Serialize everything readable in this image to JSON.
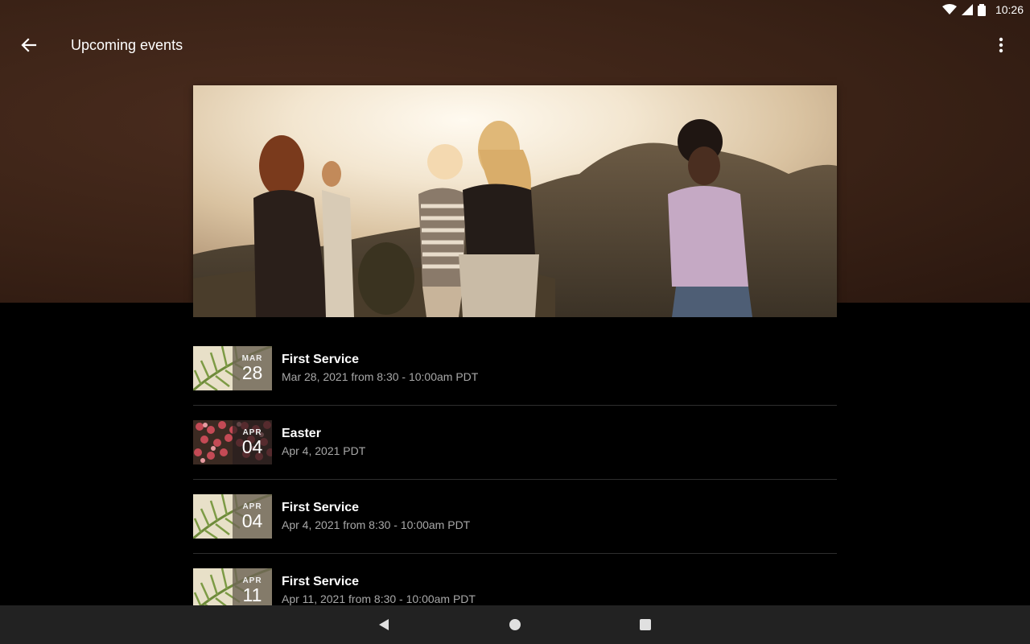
{
  "status_bar": {
    "time": "10:26",
    "icons": [
      "wifi-icon",
      "cellular-signal-icon",
      "battery-icon"
    ]
  },
  "app_bar": {
    "title": "Upcoming events",
    "back_icon": "arrow-back-icon",
    "menu_icon": "more-vert-icon"
  },
  "hero": {
    "image": "group of friends standing on a hill at sunset"
  },
  "events": [
    {
      "title": "First Service",
      "subtitle": "Mar 28, 2021 from 8:30 - 10:00am PDT",
      "month": "MAR",
      "day": "28",
      "thumbnail": "palm-leaf"
    },
    {
      "title": "Easter",
      "subtitle": "Apr 4, 2021 PDT",
      "month": "APR",
      "day": "04",
      "thumbnail": "tulips"
    },
    {
      "title": "First Service",
      "subtitle": "Apr 4, 2021 from 8:30 - 10:00am PDT",
      "month": "APR",
      "day": "04",
      "thumbnail": "palm-leaf"
    },
    {
      "title": "First Service",
      "subtitle": "Apr 11, 2021 from 8:30 - 10:00am PDT",
      "month": "APR",
      "day": "11",
      "thumbnail": "palm-leaf"
    }
  ],
  "nav_bar": {
    "icons": [
      "nav-back-icon",
      "nav-home-icon",
      "nav-recents-icon"
    ]
  },
  "colors": {
    "header_brown": "#3a2216",
    "background": "#000000",
    "divider": "#2e2e2e",
    "subtitle_gray": "#a8a8a8",
    "nav_bar": "#222222"
  }
}
